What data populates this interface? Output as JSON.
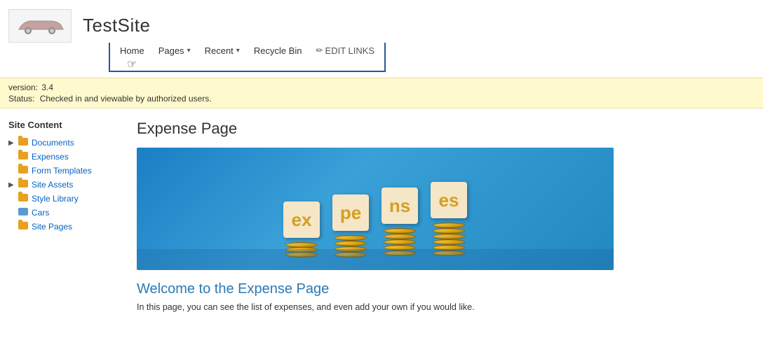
{
  "header": {
    "site_title": "TestSite",
    "logo_alt": "Site logo with car"
  },
  "nav": {
    "items": [
      {
        "label": "Home",
        "active": true,
        "has_chevron": false,
        "has_cursor": true
      },
      {
        "label": "Pages",
        "active": false,
        "has_chevron": true
      },
      {
        "label": "Recent",
        "active": false,
        "has_chevron": true
      },
      {
        "label": "Recycle Bin",
        "active": false,
        "has_chevron": false
      },
      {
        "label": "EDIT LINKS",
        "active": false,
        "has_chevron": false,
        "has_pencil": true
      }
    ]
  },
  "notification": {
    "version_label": "ersion:",
    "version_value": "3.4",
    "status_label": "tatus:",
    "status_value": "Checked in and viewable by authorized users."
  },
  "sidebar": {
    "title": "Site Content",
    "items": [
      {
        "label": "Documents",
        "expandable": true,
        "icon": "folder"
      },
      {
        "label": "Expenses",
        "expandable": false,
        "icon": "folder"
      },
      {
        "label": "Form Templates",
        "expandable": false,
        "icon": "folder",
        "indent": true
      },
      {
        "label": "Site Assets",
        "expandable": true,
        "icon": "folder"
      },
      {
        "label": "Style Library",
        "expandable": false,
        "icon": "folder"
      },
      {
        "label": "Cars",
        "expandable": false,
        "icon": "picture"
      },
      {
        "label": "Site Pages",
        "expandable": false,
        "icon": "folder"
      }
    ]
  },
  "content": {
    "page_title": "Expense Page",
    "hero_letters": [
      "ex",
      "pe",
      "ns",
      "es"
    ],
    "welcome_heading": "Welcome to the Expense Page",
    "welcome_text": "In this page, you can see the list of expenses, and even add your own if you would like."
  }
}
